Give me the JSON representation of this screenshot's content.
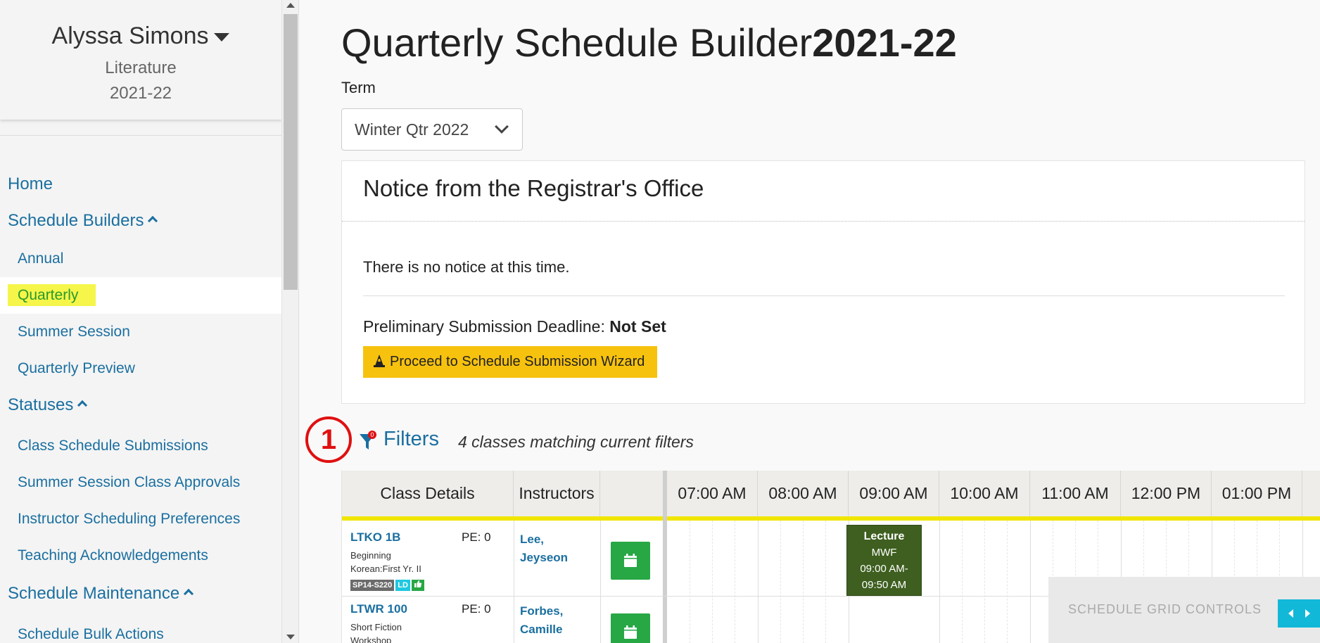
{
  "user": {
    "name": "Alyssa Simons",
    "department": "Literature",
    "year": "2021-22"
  },
  "nav": {
    "home": "Home",
    "schedule_builders": "Schedule Builders",
    "annual": "Annual",
    "quarterly": "Quarterly",
    "summer_session": "Summer Session",
    "quarterly_preview": "Quarterly Preview",
    "statuses": "Statuses",
    "class_schedule_submissions": "Class Schedule Submissions",
    "summer_session_class_approvals": "Summer Session Class Approvals",
    "instructor_scheduling_preferences": "Instructor Scheduling Preferences",
    "teaching_acknowledgements": "Teaching Acknowledgements",
    "schedule_maintenance": "Schedule Maintenance",
    "schedule_bulk_actions": "Schedule Bulk Actions"
  },
  "page": {
    "title": "Quarterly Schedule Builder",
    "title_year": "2021-22",
    "term_label": "Term",
    "term_value": "Winter Qtr 2022"
  },
  "notice": {
    "title": "Notice from the Registrar's Office",
    "text": "There is no notice at this time.",
    "deadline_label": "Preliminary Submission Deadline:",
    "deadline_value": "Not Set",
    "wizard_button": "Proceed to Schedule Submission Wizard"
  },
  "filters": {
    "annotation": "1",
    "badge_count": "0",
    "label": "Filters",
    "match_text": "4 classes matching current filters"
  },
  "table": {
    "headers": {
      "class_details": "Class Details",
      "instructors": "Instructors",
      "times": [
        "07:00 AM",
        "08:00 AM",
        "09:00 AM",
        "10:00 AM",
        "11:00 AM",
        "12:00 PM",
        "01:00 PM"
      ]
    },
    "rows": [
      {
        "code": "LTKO 1B",
        "pe": "PE: 0",
        "desc1": "Beginning",
        "desc2": "Korean:First Yr. II",
        "badge_room": "SP14-S220",
        "badge_ld": "LD",
        "instructor1": "Lee,",
        "instructor2": "Jeyseon"
      },
      {
        "code": "LTWR 100",
        "pe": "PE: 0",
        "desc1": "Short Fiction",
        "desc2": "Workshop",
        "instructor1": "Forbes,",
        "instructor2": "Camille"
      }
    ],
    "lecture": {
      "type": "Lecture",
      "days": "MWF",
      "time1": "09:00 AM-",
      "time2": "09:50 AM"
    }
  },
  "grid_controls": {
    "label": "SCHEDULE GRID CONTROLS"
  },
  "colors": {
    "link": "#1a6fa0",
    "highlight": "#f5f54a",
    "wizard": "#f7c20e",
    "calendar_button": "#28a745",
    "lecture": "#3e5f1f",
    "header_underline": "#f0e600",
    "annotation": "#e01010"
  }
}
